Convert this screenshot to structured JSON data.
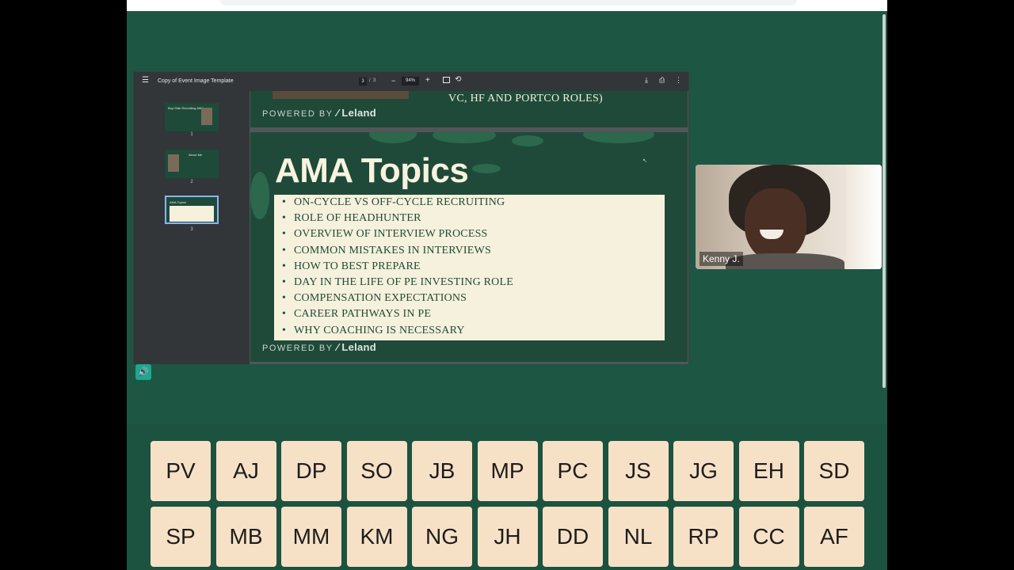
{
  "viewer": {
    "doc_title": "Copy of Event Image Template",
    "current_page": "3",
    "total_pages": "3",
    "separator": "/",
    "zoom": "94%",
    "thumbnails": [
      {
        "num": "1",
        "text": "Buy-Side Recruiting AMA"
      },
      {
        "num": "2",
        "text": "About Me"
      },
      {
        "num": "3",
        "text": "AMA Topics"
      }
    ]
  },
  "prev_slide": {
    "header_text": "VC, HF AND PORTCO ROLES)",
    "powered_by": "POWERED BY",
    "brand": "Leland"
  },
  "slide": {
    "title": "AMA Topics",
    "topics": [
      "ON-CYCLE VS OFF-CYCLE RECRUITING",
      "ROLE OF HEADHUNTER",
      "OVERVIEW OF INTERVIEW PROCESS",
      "COMMON MISTAKES IN INTERVIEWS",
      "HOW TO BEST PREPARE",
      "DAY IN THE LIFE OF PE INVESTING ROLE",
      "COMPENSATION EXPECTATIONS",
      "CAREER PATHWAYS IN PE",
      "WHY COACHING IS NECESSARY"
    ],
    "powered_by": "POWERED BY",
    "brand": "Leland"
  },
  "video": {
    "participant_name": "Kenny J."
  },
  "participants": {
    "row1": [
      "PV",
      "AJ",
      "DP",
      "SO",
      "JB",
      "MP",
      "PC",
      "JS",
      "JG",
      "EH",
      "SD"
    ],
    "row2": [
      "SP",
      "MB",
      "MM",
      "KM",
      "NG",
      "JH",
      "DD",
      "NL",
      "RP",
      "CC",
      "AF"
    ]
  },
  "colors": {
    "background": "#1e5644",
    "tile": "#f7e1c6",
    "slide_green": "#1f4a3a",
    "topic_box": "#f6f1dc"
  }
}
